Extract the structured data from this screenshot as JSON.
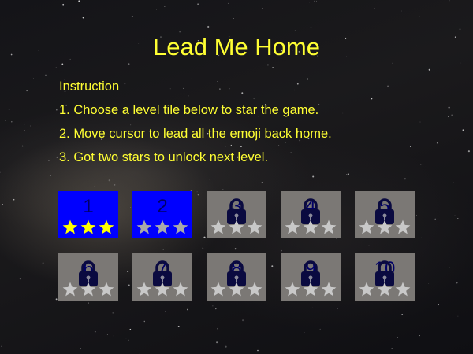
{
  "title": "Lead Me Home",
  "instructions": {
    "heading": "Instruction",
    "step1": "1. Choose a level tile below to star the game.",
    "step2": "2. Move cursor to lead all the emoji back home.",
    "step3": "3. Got two stars to unlock next level."
  },
  "levels": [
    {
      "number": "1",
      "locked": false,
      "stars_earned": 3
    },
    {
      "number": "2",
      "locked": false,
      "stars_earned": 0
    },
    {
      "number": "3",
      "locked": true,
      "stars_earned": 0
    },
    {
      "number": "4",
      "locked": true,
      "stars_earned": 0
    },
    {
      "number": "5",
      "locked": true,
      "stars_earned": 0
    },
    {
      "number": "6",
      "locked": true,
      "stars_earned": 0
    },
    {
      "number": "7",
      "locked": true,
      "stars_earned": 0
    },
    {
      "number": "8",
      "locked": true,
      "stars_earned": 0
    },
    {
      "number": "9",
      "locked": true,
      "stars_earned": 0
    },
    {
      "number": "10",
      "locked": true,
      "stars_earned": 0
    }
  ],
  "colors": {
    "title": "#ffff33",
    "unlocked_tile": "#0000ff",
    "locked_tile": "#7b7875",
    "star_earned": "#ffff00",
    "star_empty_unlocked": "#a9a9a9",
    "star_empty_locked": "#c8c8c8",
    "lock_icon": "#0a0a40"
  },
  "icons": {
    "lock": "padlock-icon",
    "star": "star-icon"
  }
}
